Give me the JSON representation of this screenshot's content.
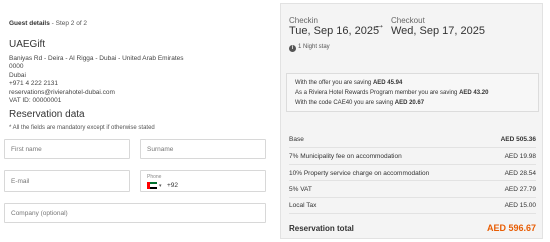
{
  "guest": {
    "title": "Guest details",
    "step": " - Step 2 of 2"
  },
  "hotel": {
    "name": "UAEGift",
    "address": "Baniyas Rd - Deira - Al Rigga - Dubai - United Arab Emirates",
    "postal": "0000",
    "city": "Dubai",
    "phone": "+971 4 222 2131",
    "email": "reservations@rivierahotel-dubai.com",
    "vat": "VAT ID: 00000001"
  },
  "form": {
    "title": "Reservation data",
    "mandatory_note": "* All the fields are mandatory except if otherwise stated",
    "first_name_placeholder": "First name",
    "surname_placeholder": "Surname",
    "email_placeholder": "E-mail",
    "phone_label": "Phone",
    "dial_code": "+92",
    "company_placeholder": "Company (optional)"
  },
  "stay": {
    "checkin_label": "Checkin",
    "checkin_date": "Tue, Sep 16, 2025",
    "arrow": "→",
    "checkout_label": "Checkout",
    "checkout_date": "Wed, Sep 17, 2025",
    "nights": "1 Night stay",
    "info_icon": "i"
  },
  "savings": {
    "offer_text": "With the offer you are saving ",
    "offer_amount": "AED 45.94",
    "program_text": "As a Riviera Hotel Rewards Program member you are saving ",
    "program_amount": "AED 43.20",
    "code_text": "With the code CAE40 you are saving ",
    "code_amount": "AED 20.67"
  },
  "summary": {
    "base_label": "Base",
    "base_amount": "AED 505.36",
    "muni_label": "7% Municipality fee on accommodation",
    "muni_amount": "AED 19.98",
    "prop_label": "10% Property service charge on accommodation",
    "prop_amount": "AED 28.54",
    "vat_label": "5% VAT",
    "vat_amount": "AED 27.79",
    "tax_label": "Local Tax",
    "tax_amount": "AED 15.00",
    "total_label": "Reservation total",
    "total_amount": "AED 596.67"
  },
  "colors": {
    "accent": "#e85d04",
    "panel_bg": "#f4f4f4"
  }
}
